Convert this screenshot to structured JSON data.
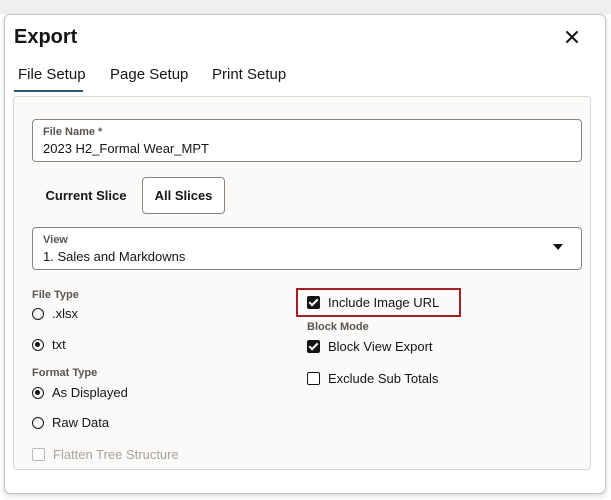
{
  "dialog": {
    "title": "Export"
  },
  "tabs": [
    {
      "label": "File Setup",
      "active": true
    },
    {
      "label": "Page Setup",
      "active": false
    },
    {
      "label": "Print Setup",
      "active": false
    }
  ],
  "file_name": {
    "label": "File Name *",
    "value": "2023 H2_Formal Wear_MPT"
  },
  "slices": {
    "current": "Current Slice",
    "all": "All Slices",
    "selected": "All Slices"
  },
  "view": {
    "label": "View",
    "value": "1. Sales and Markdowns"
  },
  "file_type": {
    "label": "File Type",
    "options": [
      {
        "label": ".xlsx",
        "selected": false
      },
      {
        "label": "txt",
        "selected": true
      }
    ]
  },
  "format_type": {
    "label": "Format Type",
    "options": [
      {
        "label": "As Displayed",
        "selected": true
      },
      {
        "label": "Raw Data",
        "selected": false
      }
    ]
  },
  "flatten_tree": {
    "label": "Flatten Tree Structure",
    "checked": false,
    "disabled": true
  },
  "include_image_url": {
    "label": "Include Image URL",
    "checked": true
  },
  "block_mode": {
    "label": "Block Mode"
  },
  "block_view_export": {
    "label": "Block View Export",
    "checked": true
  },
  "exclude_sub_totals": {
    "label": "Exclude Sub Totals",
    "checked": false
  },
  "colors": {
    "highlight": "#a71d24",
    "tab_underline": "#2c5967"
  }
}
